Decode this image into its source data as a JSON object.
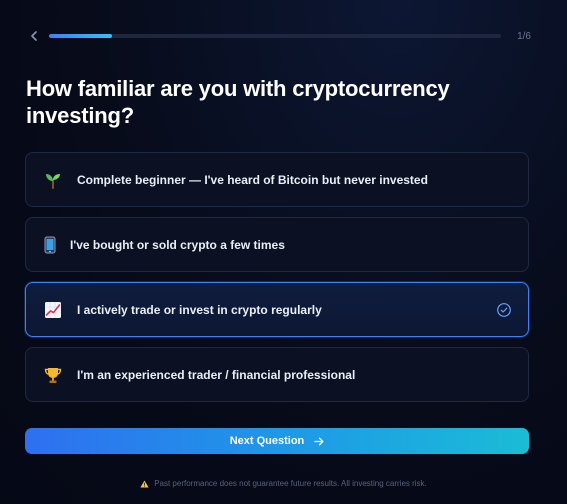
{
  "progress": {
    "step_label": "1/6",
    "fraction": 0.14
  },
  "question": {
    "title": "How familiar are you with cryptocurrency investing?"
  },
  "options": [
    {
      "icon": "seedling-icon",
      "label": "Complete beginner — I've heard of Bitcoin but never invested",
      "selected": false
    },
    {
      "icon": "mobile-phone-icon",
      "label": "I've bought or sold crypto a few times",
      "selected": false
    },
    {
      "icon": "chart-increasing-icon",
      "label": "I actively trade or invest in crypto regularly",
      "selected": true
    },
    {
      "icon": "trophy-icon",
      "label": "I'm an experienced trader / financial professional",
      "selected": false
    }
  ],
  "cta": {
    "label": "Next Question"
  },
  "disclaimer": {
    "text": "Past performance does not guarantee future results. All investing carries risk."
  },
  "colors": {
    "accent": "#3b82f6",
    "background": "#070b1a",
    "cta_end": "#1bbcd6"
  }
}
